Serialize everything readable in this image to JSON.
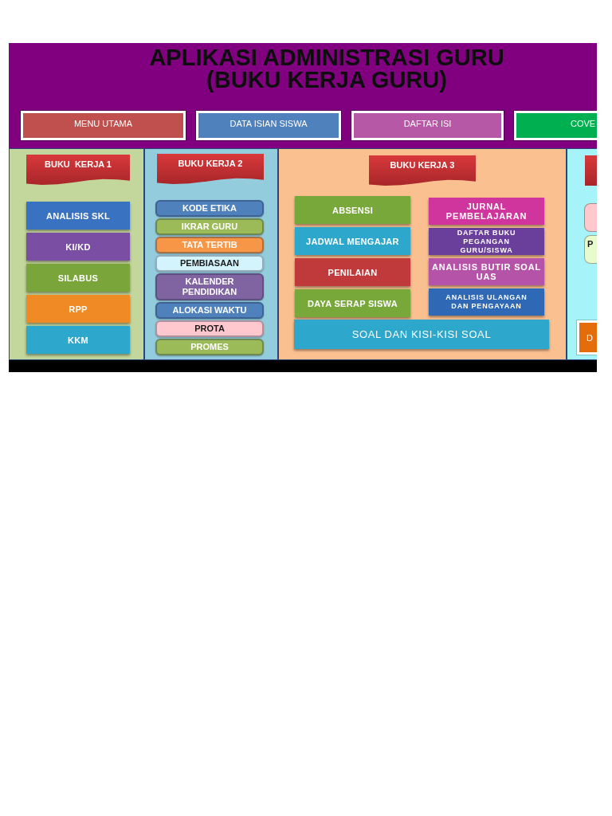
{
  "header": {
    "title_lines": [
      "APLIKASI ADMINISTRASI GURU",
      "(BUKU KERJA GURU)"
    ]
  },
  "nav_buttons": [
    {
      "label": "MENU UTAMA",
      "color": "#c0504d"
    },
    {
      "label": "DATA ISIAN SISWA",
      "color": "#4f81bd"
    },
    {
      "label": "DAFTAR ISI",
      "color": "#b658a6"
    },
    {
      "label": "COVE",
      "color": "#00b050"
    }
  ],
  "panels": [
    {
      "kind": "column",
      "color": "#c3d69b",
      "banner": {
        "label": "BUKU  KERJA 1"
      },
      "buttons": [
        {
          "kind": "tile",
          "label": "ANALISIS SKL",
          "color": "#3a72c2"
        },
        {
          "kind": "tile",
          "label": "KI/KD",
          "color": "#7a4fa3"
        },
        {
          "kind": "tile",
          "label": "SILABUS",
          "color": "#79a53b"
        },
        {
          "kind": "tile",
          "label": "RPP",
          "color": "#f08a24"
        },
        {
          "kind": "tile",
          "label": "KKM",
          "color": "#2ea7cc"
        }
      ]
    },
    {
      "kind": "column",
      "color": "#93cddd",
      "banner": {
        "label": "BUKU KERJA 2"
      },
      "buttons": [
        {
          "kind": "pill",
          "label": "KODE ETIKA",
          "color": "#4f81bd"
        },
        {
          "kind": "pill",
          "label": "IKRAR GURU",
          "color": "#9bbb59"
        },
        {
          "kind": "pill",
          "label": "TATA TERTIB",
          "color": "#f79646"
        },
        {
          "kind": "pill",
          "label": "PEMBIASAAN",
          "color": "#d4f4fd"
        },
        {
          "kind": "pill",
          "label": "KALENDER PENDIDIKAN",
          "color": "#8064a2"
        },
        {
          "kind": "pill",
          "label": "ALOKASI WAKTU",
          "color": "#4f81bd"
        },
        {
          "kind": "pill",
          "label": "PROTA",
          "color": "#ffc7ce"
        },
        {
          "kind": "pill",
          "label": "PROMES",
          "color": "#9bbb59"
        }
      ]
    },
    {
      "kind": "grid",
      "color": "#fac090",
      "banner": {
        "label": "BUKU KERJA 3"
      },
      "columns": [
        [
          {
            "kind": "tile",
            "label": "ABSENSI",
            "color": "#79a83a"
          },
          {
            "kind": "tile",
            "label": "JADWAL MENGAJAR",
            "color": "#2ea7cc"
          },
          {
            "kind": "tile",
            "label": "PENILAIAN",
            "color": "#c0393b"
          },
          {
            "kind": "tile",
            "label": "DAYA SERAP SISWA",
            "color": "#79a83a"
          }
        ],
        [
          {
            "kind": "tile",
            "label": "JURNAL PEMBELAJARAN",
            "color": "#d0359d"
          },
          {
            "kind": "tile-small",
            "label": "DAFTAR BUKU PEGANGAN GURU/SISWA",
            "color": "#6a3f9c"
          },
          {
            "kind": "tile",
            "label": "ANALISIS BUTIR SOAL UAS",
            "color": "#b553a9"
          },
          {
            "kind": "tile-small",
            "label": "ANALISIS ULANGAN DAN PENGAYAAN",
            "color": "#2f68b4"
          }
        ]
      ],
      "footer_button": {
        "kind": "wide",
        "label": "SOAL DAN KISI-KISI SOAL",
        "color": "#2ea7cc"
      }
    },
    {
      "kind": "edge",
      "color": "#a6f4fa",
      "buttons": [
        {
          "kind": "rounded",
          "color": "#ffc8cc"
        },
        {
          "kind": "rounded",
          "label": "P",
          "color": "#e8fbcd"
        },
        {
          "kind": "framed",
          "label": "D",
          "color": "#e46c0a"
        }
      ]
    }
  ]
}
